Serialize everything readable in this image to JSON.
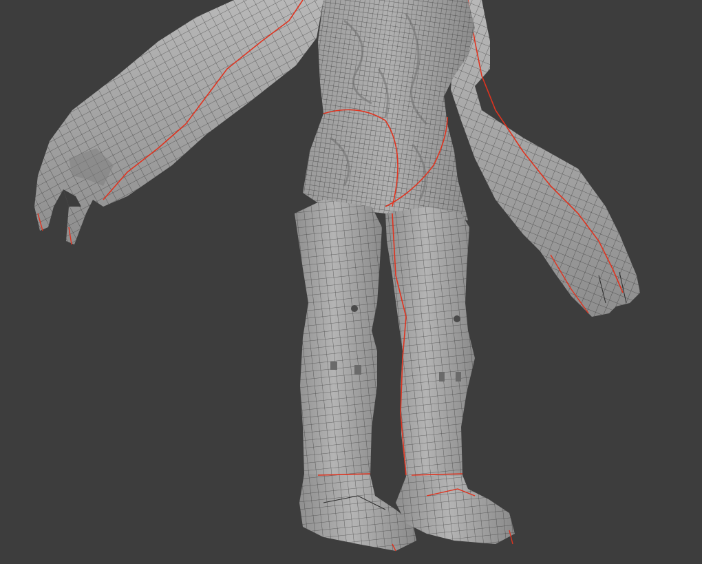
{
  "viewport": {
    "background_color": "#3d3d3d",
    "mesh_fill_color": "#a9a9a9",
    "mesh_shade_color": "#8e8e8e",
    "mesh_highlight_color": "#c8c8c8",
    "wire_color": "#2b2b2b",
    "seam_color": "#e0331f"
  }
}
